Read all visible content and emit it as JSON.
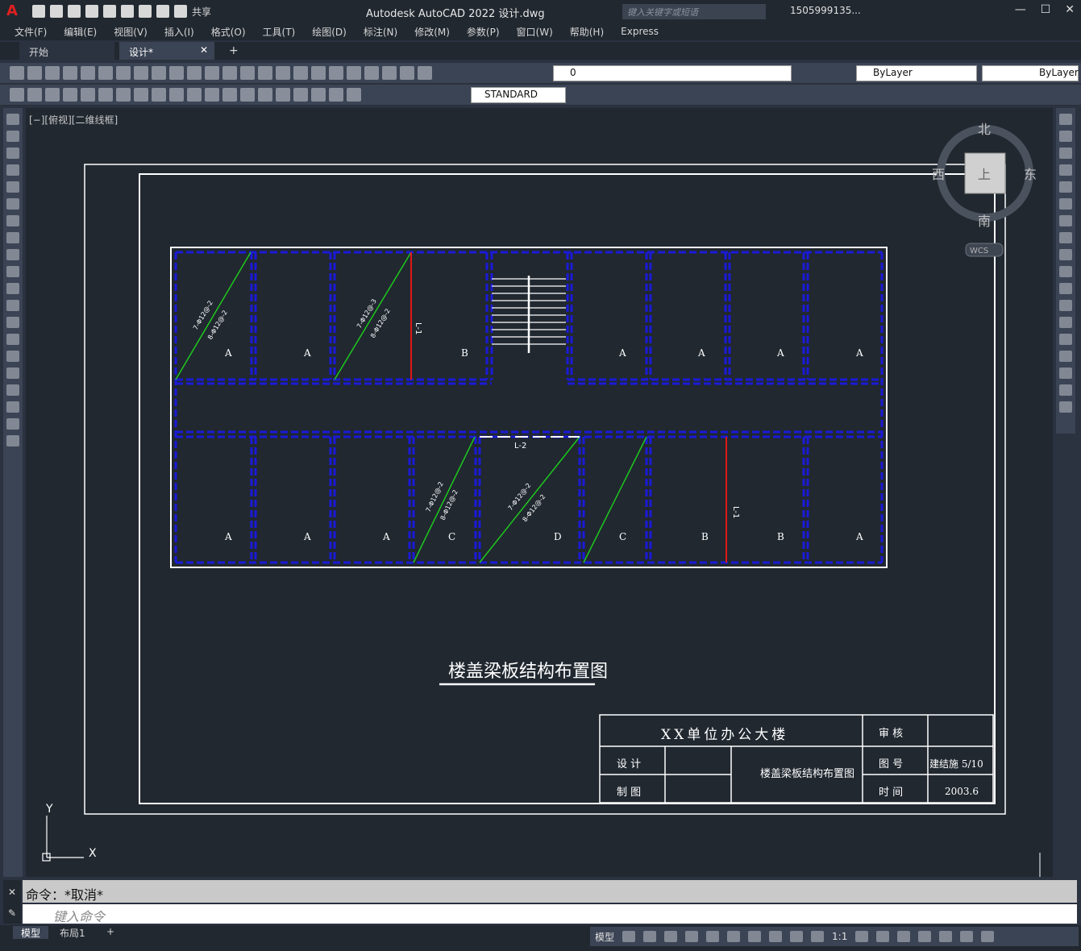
{
  "app": {
    "title": "Autodesk AutoCAD 2022    设计.dwg",
    "logo": "A",
    "share_label": "共享",
    "search_placeholder": "键入关键字或短语",
    "user": "1505999135...",
    "window_controls": [
      "minimize-icon",
      "maximize-icon",
      "close-icon"
    ]
  },
  "menu": [
    "文件(F)",
    "编辑(E)",
    "视图(V)",
    "插入(I)",
    "格式(O)",
    "工具(T)",
    "绘图(D)",
    "标注(N)",
    "修改(M)",
    "参数(P)",
    "窗口(W)",
    "帮助(H)",
    "Express"
  ],
  "tabs": {
    "start": "开始",
    "active": "设计*"
  },
  "toolbar": {
    "layer_value": "0",
    "color_value": "ByLayer",
    "linetype_value": "ByLayer",
    "textstyle_value": "STANDARD"
  },
  "canvas": {
    "view_label": "[−][俯视][二维线框]",
    "viewcube": {
      "north": "北",
      "south": "南",
      "east": "东",
      "west": "西",
      "top": "上",
      "wcs": "WCS"
    },
    "ucs": {
      "x": "X",
      "y": "Y"
    }
  },
  "drawing": {
    "title": "楼盖梁板结构布置图",
    "title_block": {
      "project": "XX单位办公大楼",
      "review": "审 核",
      "design": "设 计",
      "draft": "制 图",
      "drawing_name": "楼盖梁板结构布置图",
      "drawing_no_label": "图 号",
      "drawing_no": "建结施  5/10",
      "date_label": "时 间",
      "date": "2003.6"
    },
    "top_rooms": [
      "A",
      "A",
      "B",
      "A",
      "A",
      "A",
      "A"
    ],
    "bottom_rooms": [
      "A",
      "A",
      "A",
      "C",
      "D",
      "C",
      "B",
      "B",
      "A"
    ],
    "beam_labels": [
      "L-1",
      "L-2",
      "L-1"
    ],
    "rebar_labels": [
      "7-Φ12@-2",
      "8-Φ12@-2",
      "7-Φ12@-3",
      "8-Φ12@-2",
      "7-Φ12@-2",
      "8-Φ12@-2",
      "7-Φ12@-2",
      "8-Φ12@-2"
    ]
  },
  "command": {
    "history": "命令：*取消*",
    "placeholder": "键入命令"
  },
  "bottom_tabs": {
    "model": "模型",
    "layout": "布局1",
    "add": "+"
  },
  "status": {
    "mode": "模型",
    "scale": "1:1"
  }
}
